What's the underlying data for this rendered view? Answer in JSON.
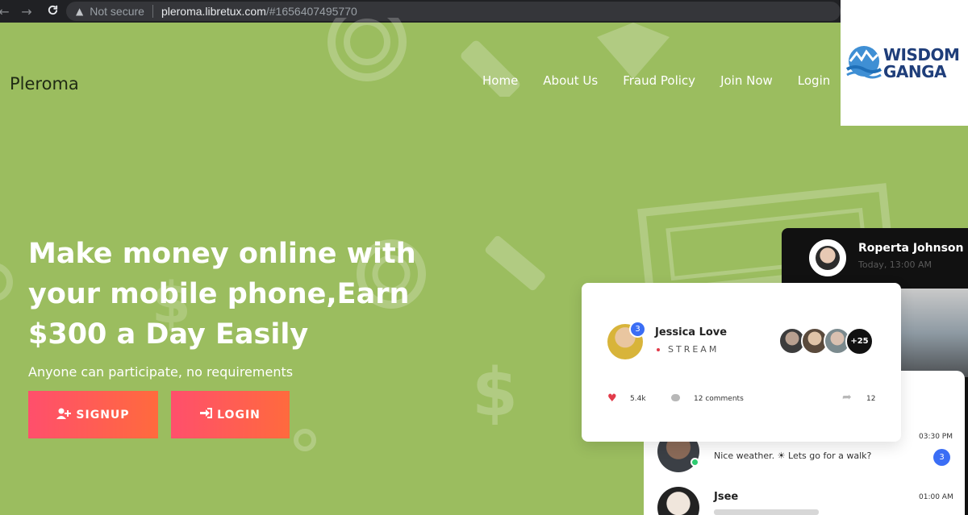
{
  "browser": {
    "back_icon": "←",
    "forward_icon": "→",
    "reload_icon": "C",
    "warning_icon": "▲",
    "security_label": "Not secure",
    "url_host": "pleroma.libretux.com",
    "url_rest": "/#1656407495770"
  },
  "header": {
    "brand": "Pleroma",
    "nav": [
      "Home",
      "About Us",
      "Fraud Policy",
      "Join Now",
      "Login"
    ]
  },
  "watermark": {
    "line1": "WISDOM",
    "line2": "GANGA"
  },
  "hero": {
    "title": "Make money online with your mobile phone,Earn $300 a Day Easily",
    "subtitle": "Anyone can participate, no requirements",
    "signup_label": "SIGNUP",
    "login_label": "LOGIN"
  },
  "mock": {
    "profile_name": "Roperta Johnson",
    "profile_time": "Today, 13:00 AM",
    "stream_user": "Jessica Love",
    "stream_label": "STREAM",
    "stream_badge": "3",
    "viewers_extra": "+25",
    "likes": "5.4k",
    "comments": "12 comments",
    "shares": "12",
    "chat_time_1": "03:30 PM",
    "chat_message_1": "Nice weather. ☀ Lets go for a walk?",
    "chat_badge_1": "3",
    "chat_name_2": "Jsee",
    "chat_time_2": "01:00 AM"
  },
  "colors": {
    "background": "#9bbd5f",
    "button_gradient_start": "#ff4f6c",
    "button_gradient_end": "#ff6a3d",
    "badge_blue": "#3b6ef5"
  }
}
